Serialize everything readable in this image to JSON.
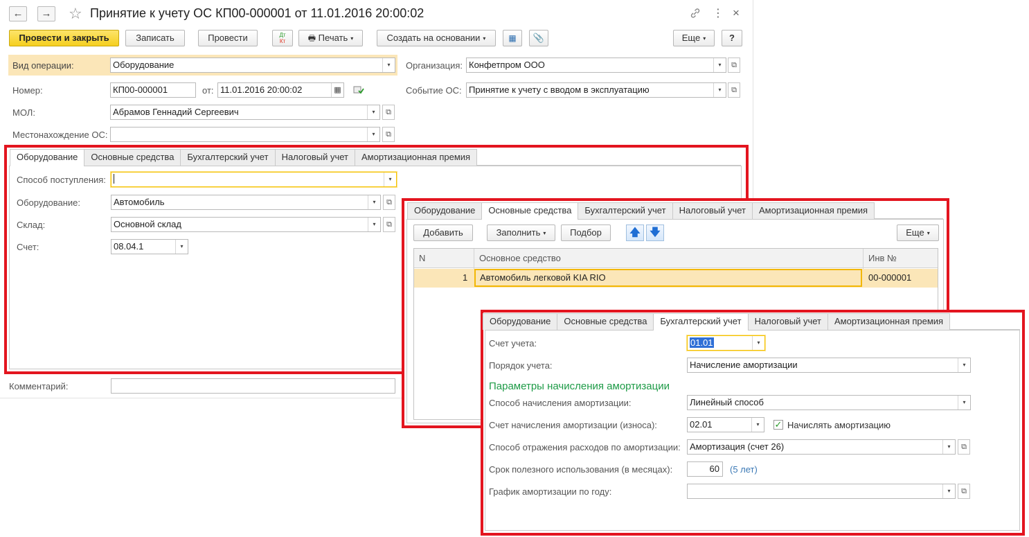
{
  "header": {
    "title": "Принятие к учету ОС КП00-000001 от 11.01.2016 20:00:02",
    "back_icon": "←",
    "forward_icon": "→",
    "star_icon": "☆",
    "link_icon": "🔗",
    "more_icon": "⋮",
    "close_icon": "×"
  },
  "toolbar": {
    "post_close": "Провести и закрыть",
    "save": "Записать",
    "post": "Провести",
    "dtkt": "Дт Кт",
    "print": "Печать",
    "create_based": "Создать на основании",
    "more": "Еще",
    "help": "?"
  },
  "form": {
    "operation_label": "Вид операции:",
    "operation_value": "Оборудование",
    "org_label": "Организация:",
    "org_value": "Конфетпром ООО",
    "number_label": "Номер:",
    "number_value": "КП00-000001",
    "date_label": "от:",
    "date_value": "11.01.2016 20:00:02",
    "event_label": "Событие ОС:",
    "event_value": "Принятие к учету с вводом в эксплуатацию",
    "mol_label": "МОЛ:",
    "mol_value": "Абрамов Геннадий Сергеевич",
    "location_label": "Местонахождение ОС:",
    "location_value": "",
    "comment_label": "Комментарий:",
    "comment_value": ""
  },
  "tabs": [
    "Оборудование",
    "Основные средства",
    "Бухгалтерский учет",
    "Налоговый учет",
    "Амортизационная премия"
  ],
  "panel1": {
    "receipt_label": "Способ поступления:",
    "receipt_value": "",
    "equipment_label": "Оборудование:",
    "equipment_value": "Автомобиль",
    "warehouse_label": "Склад:",
    "warehouse_value": "Основной склад",
    "account_label": "Счет:",
    "account_value": "08.04.1"
  },
  "panel2": {
    "add": "Добавить",
    "fill": "Заполнить",
    "select": "Подбор",
    "more": "Еще",
    "columns": [
      "N",
      "Основное средство",
      "Инв №"
    ],
    "rows": [
      {
        "n": "1",
        "asset": "Автомобиль легковой KIA RIO",
        "inv": "00-000001"
      }
    ]
  },
  "panel3": {
    "account_label": "Счет учета:",
    "account_value": "01.01",
    "order_label": "Порядок учета:",
    "order_value": "Начисление амортизации",
    "section_title": "Параметры начисления амортизации",
    "method_label": "Способ начисления амортизации:",
    "method_value": "Линейный способ",
    "depr_account_label": "Счет начисления амортизации (износа):",
    "depr_account_value": "02.01",
    "accrue_label": "Начислять амортизацию",
    "accrue_checked": true,
    "expense_label": "Способ отражения расходов по амортизации:",
    "expense_value": "Амортизация (счет 26)",
    "term_label": "Срок полезного использования (в месяцах):",
    "term_value": "60",
    "term_years": "(5 лет)",
    "schedule_label": "График амортизации по году:",
    "schedule_value": ""
  },
  "colors": {
    "red_frame": "#e3151f",
    "yellow_button": "#f5cf1f",
    "highlight_row": "#fbe6b8",
    "green_title": "#1e9b47",
    "link": "#3a78b5"
  }
}
